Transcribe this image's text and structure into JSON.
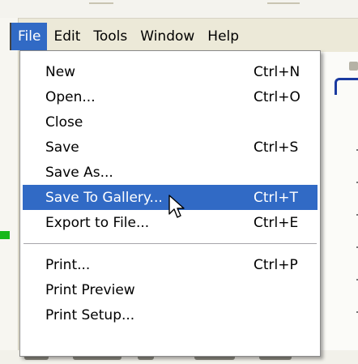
{
  "menubar": {
    "items": [
      {
        "label": "File",
        "active": true
      },
      {
        "label": "Edit",
        "active": false
      },
      {
        "label": "Tools",
        "active": false
      },
      {
        "label": "Window",
        "active": false
      },
      {
        "label": "Help",
        "active": false
      }
    ]
  },
  "file_menu": {
    "group1": [
      {
        "label": "New",
        "shortcut": "Ctrl+N"
      },
      {
        "label": "Open...",
        "shortcut": "Ctrl+O"
      },
      {
        "label": "Close",
        "shortcut": ""
      },
      {
        "label": "Save",
        "shortcut": "Ctrl+S"
      },
      {
        "label": "Save As...",
        "shortcut": ""
      },
      {
        "label": "Save To Gallery...",
        "shortcut": "Ctrl+T",
        "highlighted": true
      },
      {
        "label": "Export to File...",
        "shortcut": "Ctrl+E"
      }
    ],
    "group2": [
      {
        "label": "Print...",
        "shortcut": "Ctrl+P"
      },
      {
        "label": "Print Preview",
        "shortcut": ""
      },
      {
        "label": "Print Setup...",
        "shortcut": ""
      }
    ]
  },
  "colors": {
    "highlight": "#316ac5",
    "menubar_bg": "#ece9d8",
    "menu_bg": "#ffffff"
  },
  "icons": {
    "cursor": "arrow-cursor-icon"
  }
}
